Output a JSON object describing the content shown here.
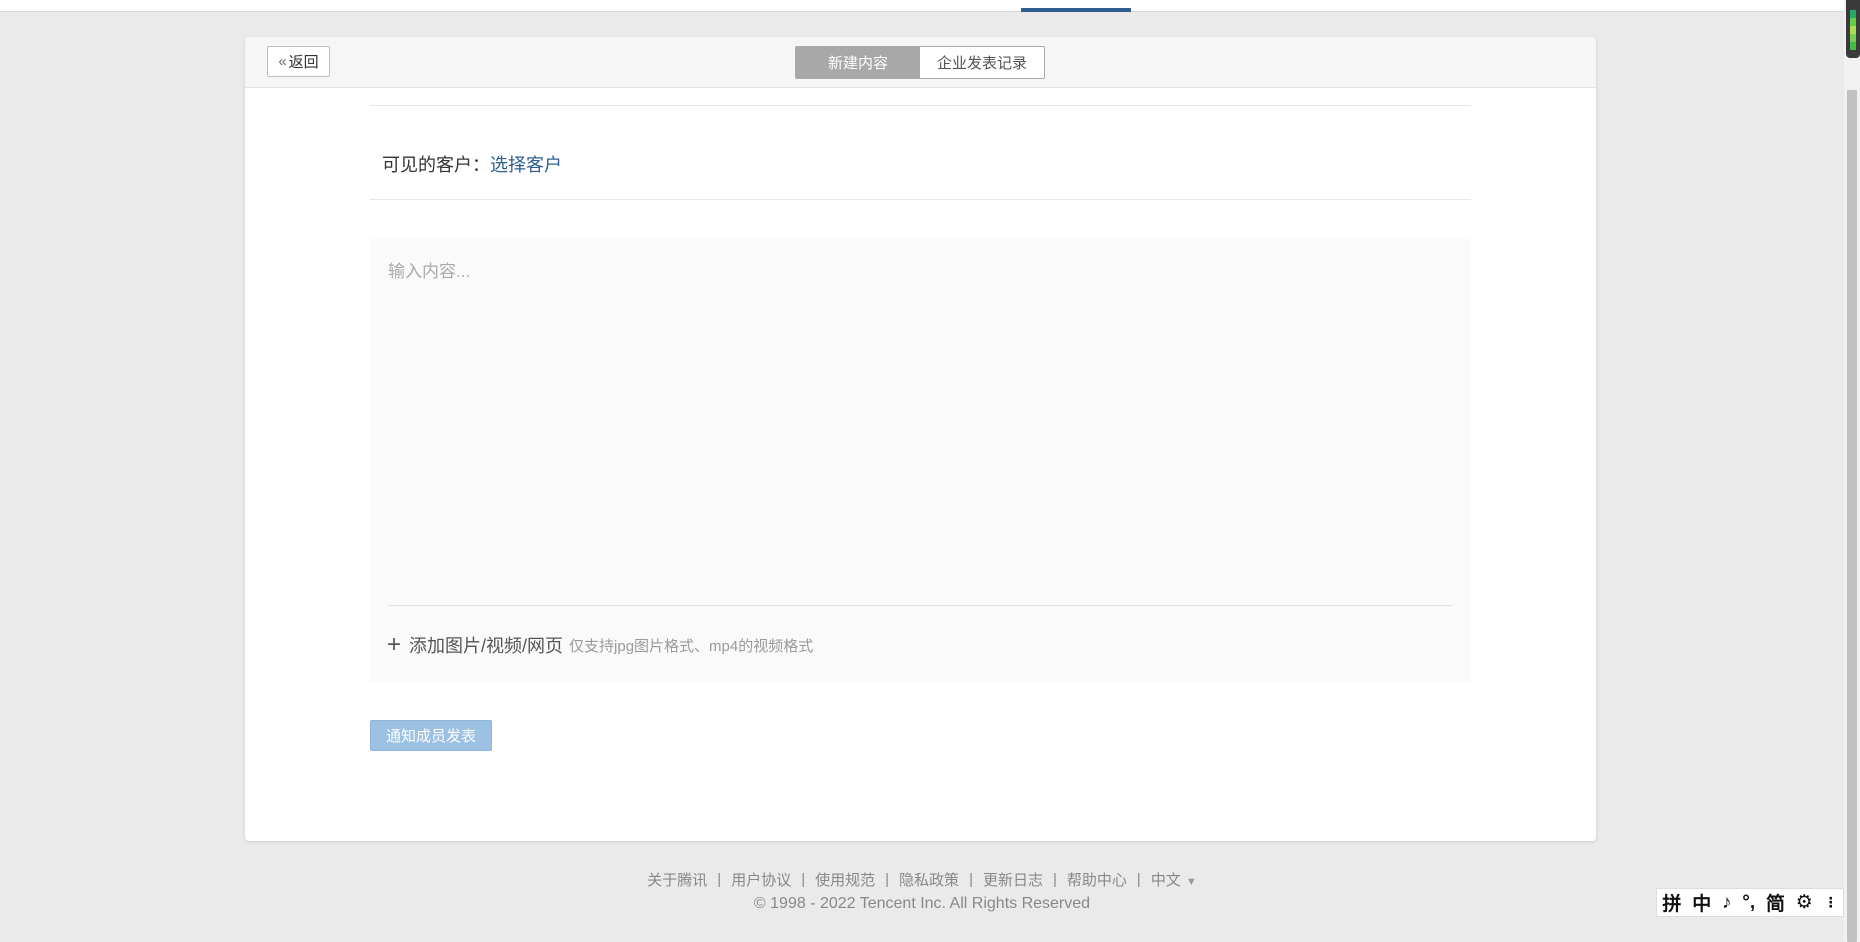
{
  "header": {
    "back_label": "返回",
    "tabs": [
      {
        "label": "新建内容",
        "active": true
      },
      {
        "label": "企业发表记录",
        "active": false
      }
    ]
  },
  "form": {
    "visible_label": "可见的客户：",
    "select_customer_link": "选择客户",
    "content_placeholder": "输入内容...",
    "add_media_label": "添加图片/视频/网页",
    "add_media_hint": "仅支持jpg图片格式、mp4的视频格式",
    "notify_button": "通知成员发表"
  },
  "footer": {
    "links": [
      "关于腾讯",
      "用户协议",
      "使用规范",
      "隐私政策",
      "更新日志",
      "帮助中心"
    ],
    "language": "中文",
    "copyright": "© 1998 - 2022 Tencent Inc. All Rights Reserved"
  },
  "ime_toolbar": {
    "items": [
      "拼",
      "中",
      "♪",
      "°,",
      "简",
      "⚙",
      "⋮"
    ]
  },
  "colors": {
    "accent": "#2e5d8e",
    "notify_button_bg": "#9cc1e3",
    "active_tab_bg": "#a8a8a8",
    "page_bg": "#eaeaeb"
  }
}
